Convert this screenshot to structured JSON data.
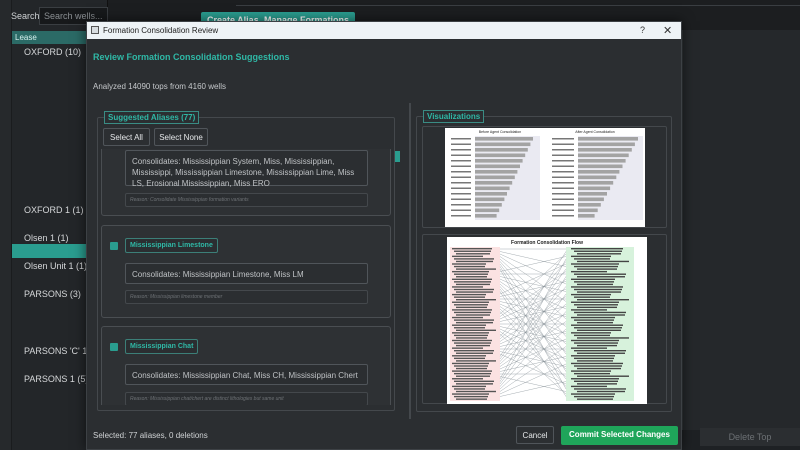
{
  "background": {
    "search_label": "Search:",
    "search_placeholder": "Search wells...",
    "lease_header": "Lease",
    "items": [
      {
        "label": "OXFORD (10)"
      },
      {
        "label": "OXFORD 1 (1)"
      },
      {
        "label": "Olsen 1 (1)"
      },
      {
        "label": "Olsen Unit 1 (1)"
      },
      {
        "label": "PARSONS (3)"
      },
      {
        "label": "PARSONS 'C' 1 (1)"
      },
      {
        "label": "PARSONS 1 (5)"
      }
    ],
    "create_alias_label": "Create Alias",
    "manage_formations_label": "Manage Formations",
    "delete_top_label": "Delete Top"
  },
  "dialog": {
    "title": "Formation Consolidation Review",
    "help": "?",
    "close": "✕",
    "heading": "Review Formation Consolidation Suggestions",
    "analyzed_text": "Analyzed 14090 tops from 4160 wells",
    "suggested_title": "Suggested Aliases (77)",
    "select_all": "Select All",
    "select_none": "Select None",
    "visualizations_title": "Visualizations",
    "cards": [
      {
        "alias": "",
        "consolidates": "Consolidates: Mississippian System, Miss, Mississippian, Mississippi, Mississippian Limestone, Mississippian Lime, Miss LS, Erosional Mississippian, Miss ERO",
        "reason": "Reason: Consolidate Mississippian formation variants"
      },
      {
        "alias": "Mississippian Limestone",
        "consolidates": "Consolidates: Mississippian Limestone, Miss LM",
        "reason": "Reason: Mississippian limestone member"
      },
      {
        "alias": "Mississippian Chat",
        "consolidates": "Consolidates: Mississippian Chat, Miss CH, Mississippian Chert",
        "reason": "Reason: Mississippian chat/chert are distinct lithologies but same unit"
      }
    ],
    "status": "Selected: 77 aliases, 0 deletions",
    "cancel": "Cancel",
    "commit": "Commit Selected Changes"
  },
  "charts": {
    "before_title": "Before Agent Consolidation",
    "after_title": "After Agent Consolidation",
    "flow_title": "Formation Consolidation Flow"
  },
  "colors": {
    "accent": "#2a9d8f",
    "commit_green": "#1fa55a",
    "bar_gray": "#a3a3a3"
  }
}
